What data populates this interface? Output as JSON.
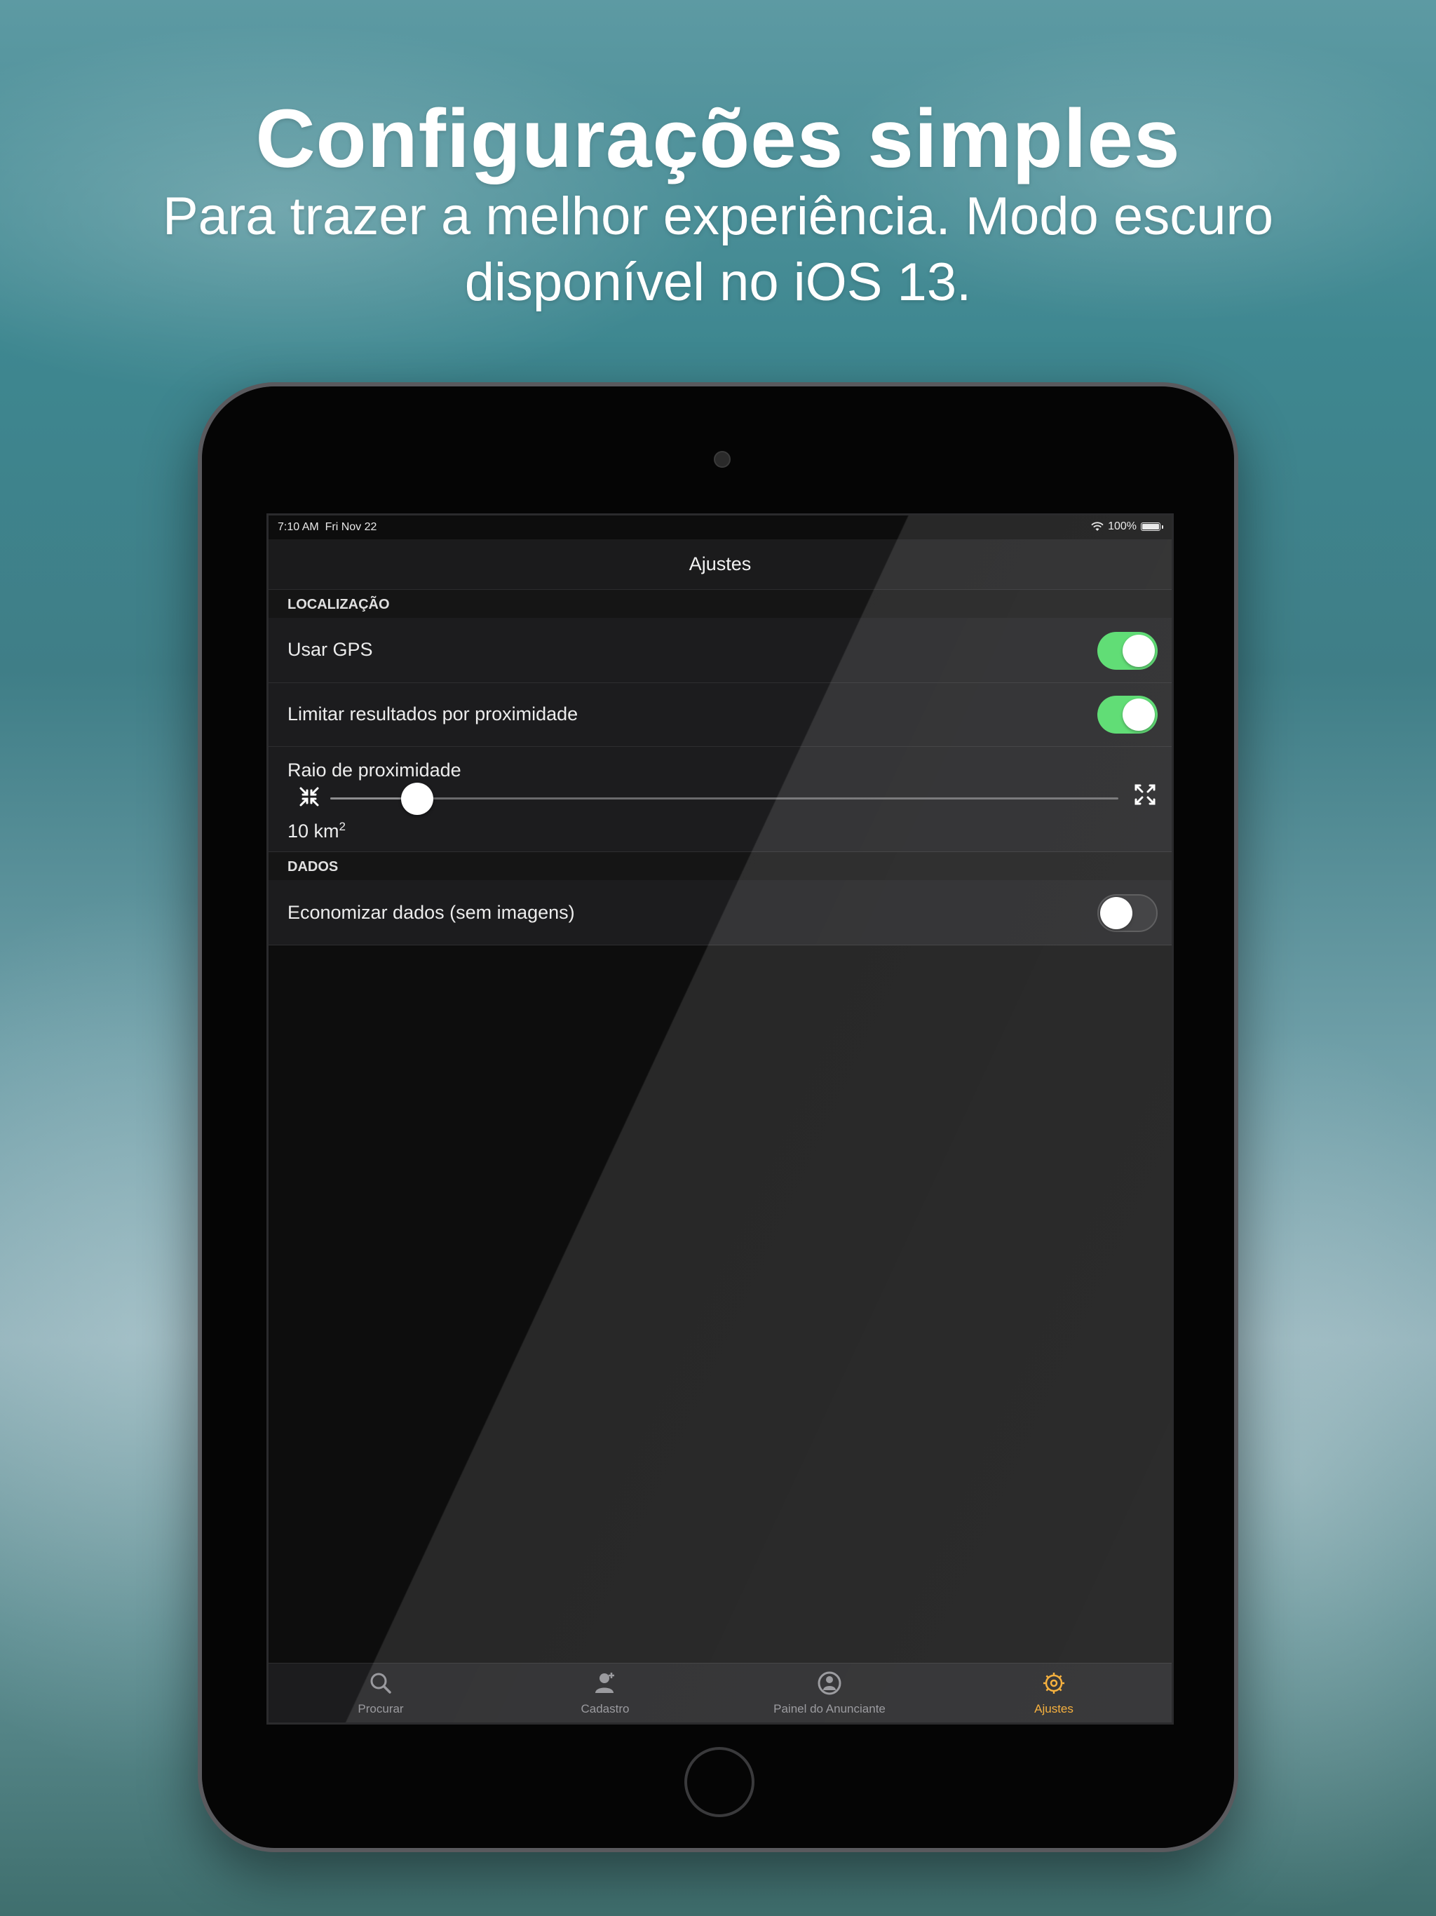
{
  "promo": {
    "headline": "Configurações simples",
    "subline": "Para trazer a melhor experiência. Modo escuro disponível no iOS 13."
  },
  "status_bar": {
    "time": "7:10 AM",
    "date": "Fri Nov 22",
    "battery": "100%"
  },
  "nav": {
    "title": "Ajustes"
  },
  "sections": {
    "location": {
      "header": "LOCALIZAÇÃO",
      "use_gps": {
        "label": "Usar GPS",
        "on": true
      },
      "limit_results": {
        "label": "Limitar resultados por proximidade",
        "on": true
      },
      "radius": {
        "label": "Raio de proximidade",
        "value_text": "10 km",
        "unit_power": "2",
        "slider_fraction": 0.11
      }
    },
    "data": {
      "header": "DADOS",
      "save_data": {
        "label": "Economizar dados (sem imagens)",
        "on": false
      }
    }
  },
  "tabbar": {
    "tabs": [
      {
        "label": "Procurar",
        "icon": "search-icon",
        "active": false
      },
      {
        "label": "Cadastro",
        "icon": "person-add-icon",
        "active": false
      },
      {
        "label": "Painel do Anunciante",
        "icon": "advertiser-panel-icon",
        "active": false
      },
      {
        "label": "Ajustes",
        "icon": "gear-icon",
        "active": true
      }
    ]
  },
  "colors": {
    "toggle_on": "#4cd964",
    "active_tab": "#f5a623",
    "inactive_tab": "#8e8e93"
  }
}
